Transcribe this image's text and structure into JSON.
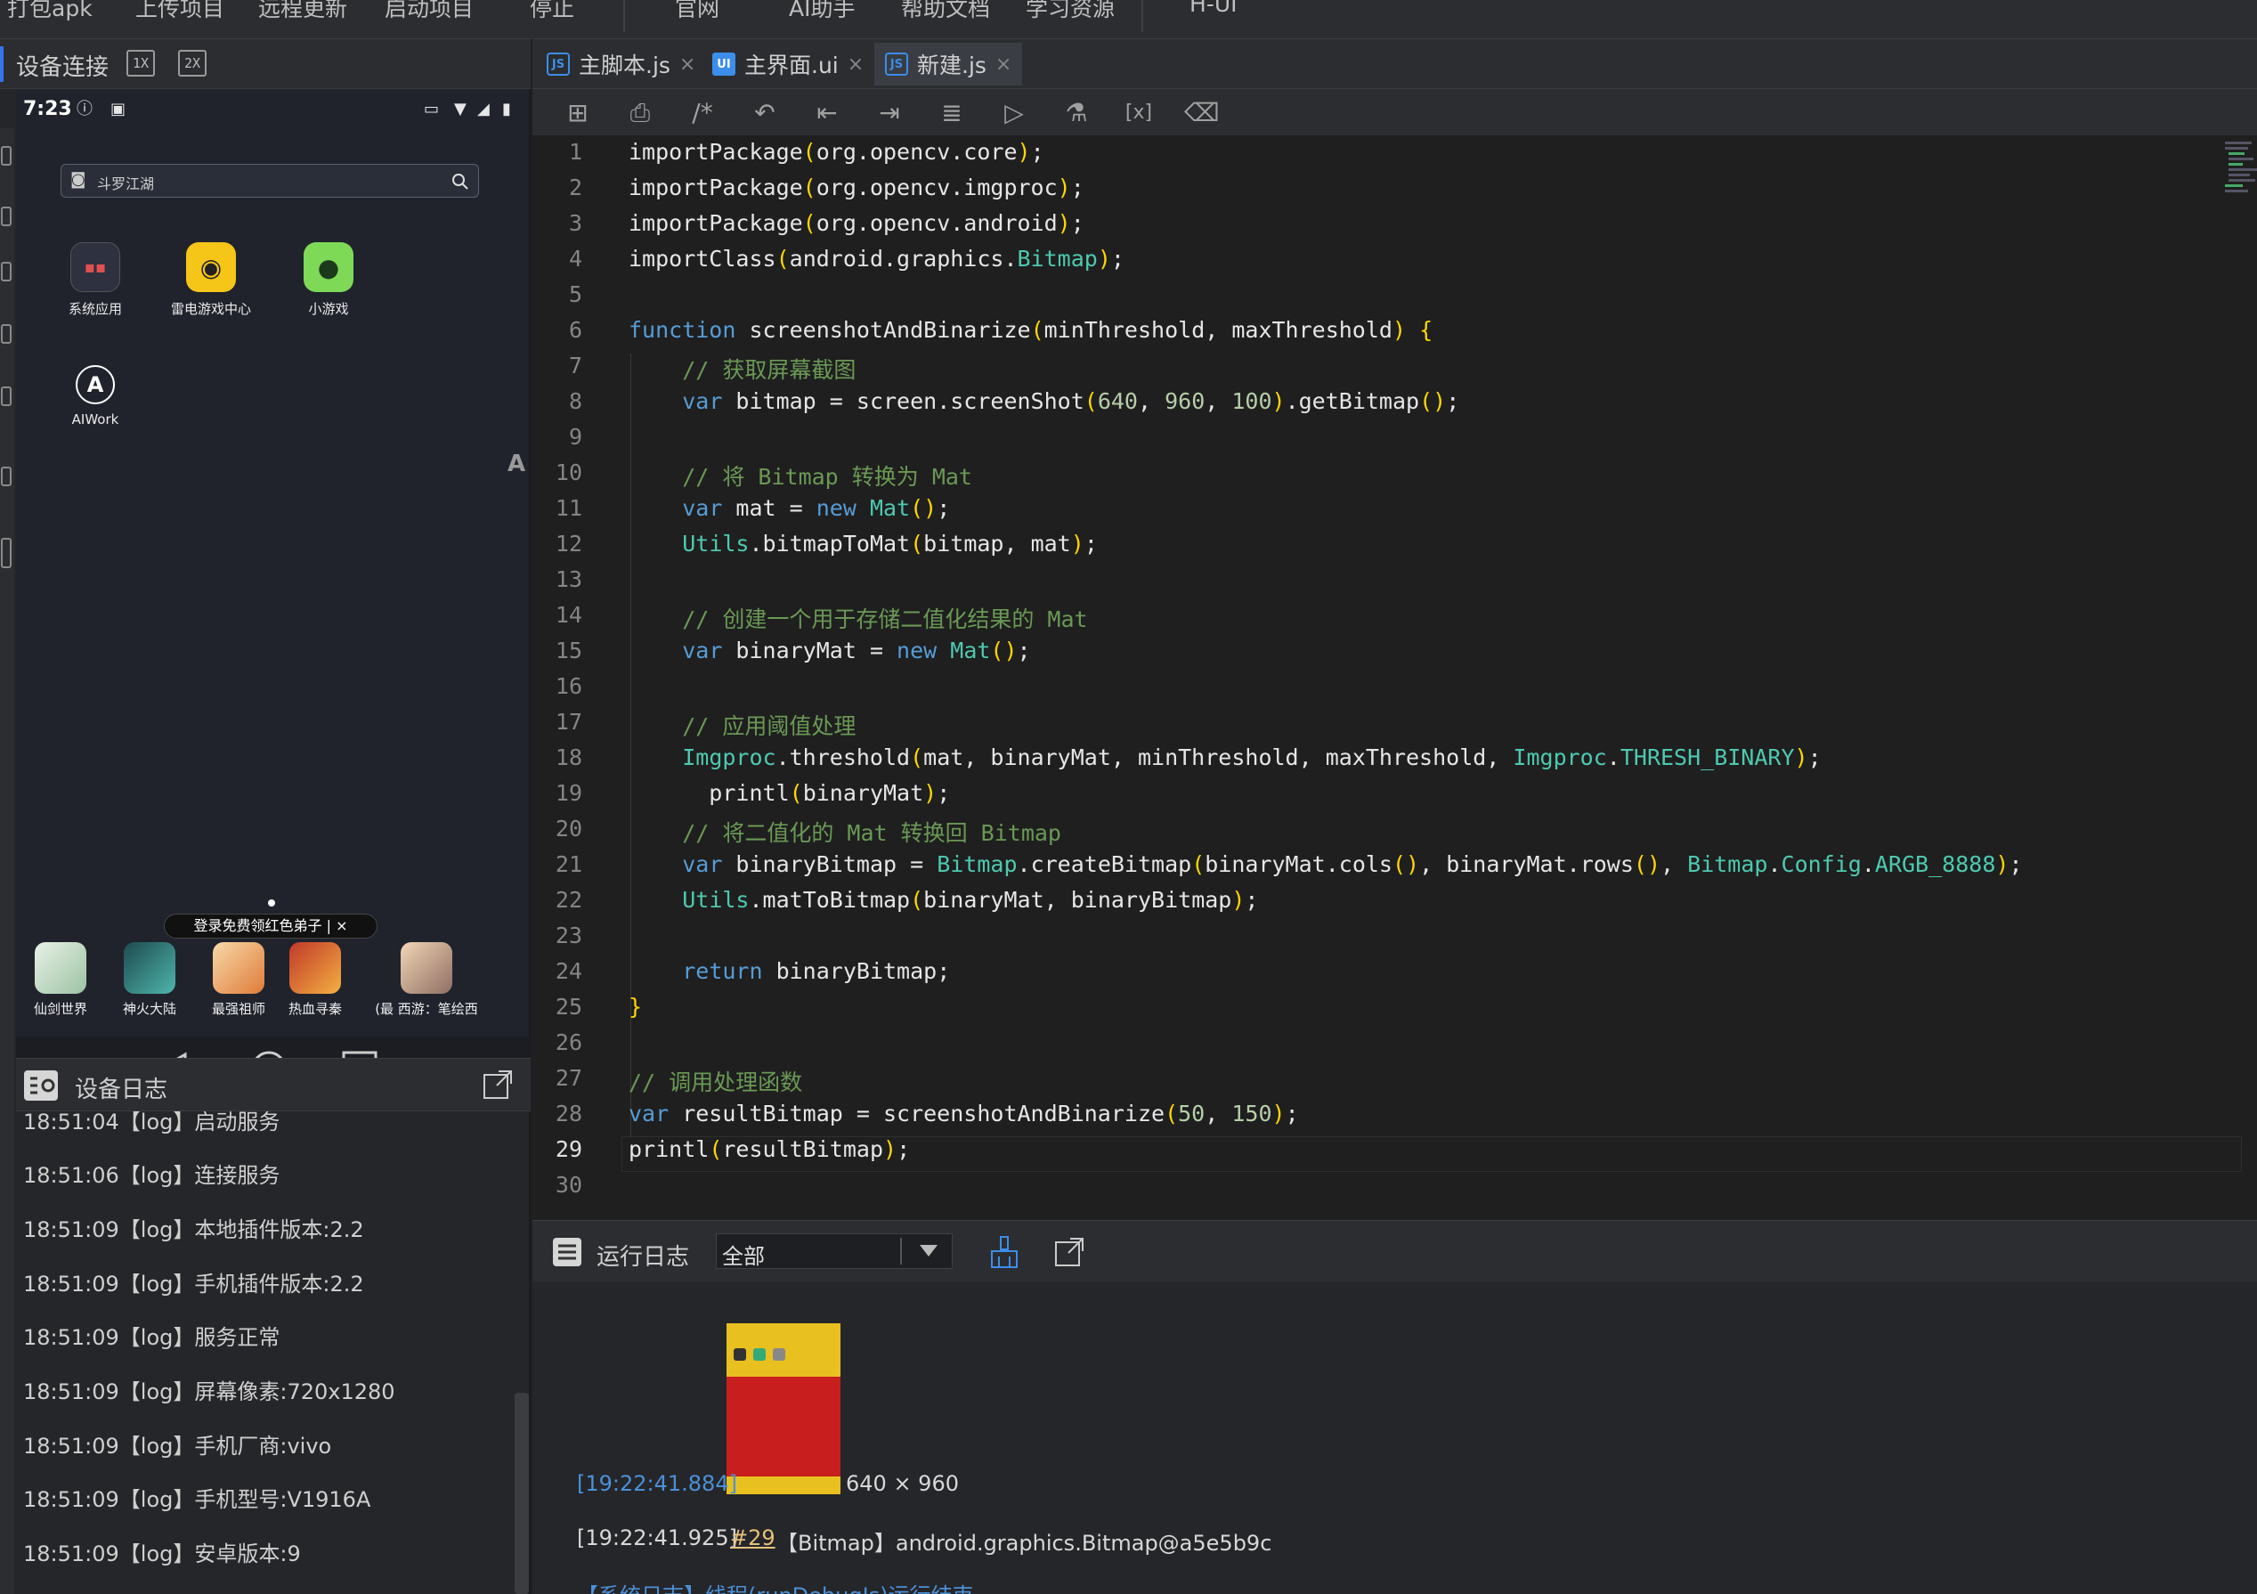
{
  "menu": {
    "items": [
      "打包apk",
      "上传项目",
      "远程更新",
      "启动项目",
      "停止",
      "官网",
      "AI助手",
      "帮助文档",
      "学习资源",
      "H-UI"
    ]
  },
  "device": {
    "title": "设备连接",
    "zoom_1x": "1X",
    "zoom_2x": "2X",
    "phone": {
      "time": "7:23",
      "search_placeholder": "斗罗江湖",
      "apps": [
        {
          "label": "系统应用"
        },
        {
          "label": "雷电游戏中心"
        },
        {
          "label": "小游戏"
        },
        {
          "label": "AIWork"
        }
      ],
      "banner": "登录免费领红色弟子 | ×",
      "dock": [
        {
          "label": "仙剑世界"
        },
        {
          "label": "神火大陆"
        },
        {
          "label": "最强祖师"
        },
        {
          "label": "热血寻秦"
        },
        {
          "label": "(最 西游：笔绘西"
        }
      ]
    },
    "log_title": "设备日志",
    "log_lines": [
      "18:51:04【log】启动服务",
      "18:51:06【log】连接服务",
      "18:51:09【log】本地插件版本:2.2",
      "18:51:09【log】手机插件版本:2.2",
      "18:51:09【log】服务正常",
      "18:51:09【log】屏幕像素:720x1280",
      "18:51:09【log】手机厂商:vivo",
      "18:51:09【log】手机型号:V1916A",
      "18:51:09【log】安卓版本:9"
    ]
  },
  "tabs": [
    {
      "label": "主脚本.js",
      "icon": "JS"
    },
    {
      "label": "主界面.ui",
      "icon": "UI"
    },
    {
      "label": "新建.js",
      "icon": "JS"
    }
  ],
  "editor": {
    "line_numbers": [
      "1",
      "2",
      "3",
      "4",
      "5",
      "6",
      "7",
      "8",
      "9",
      "10",
      "11",
      "12",
      "13",
      "14",
      "15",
      "16",
      "17",
      "18",
      "19",
      "20",
      "21",
      "22",
      "23",
      "24",
      "25",
      "26",
      "27",
      "28",
      "29",
      "30"
    ],
    "lines": [
      "importPackage(org.opencv.core);",
      "importPackage(org.opencv.imgproc);",
      "importPackage(org.opencv.android);",
      "importClass(android.graphics.Bitmap);",
      "",
      "function screenshotAndBinarize(minThreshold, maxThreshold) {",
      "    // 获取屏幕截图",
      "    var bitmap = screen.screenShot(640, 960, 100).getBitmap();",
      "",
      "    // 将 Bitmap 转换为 Mat",
      "    var mat = new Mat();",
      "    Utils.bitmapToMat(bitmap, mat);",
      "",
      "    // 创建一个用于存储二值化结果的 Mat",
      "    var binaryMat = new Mat();",
      "",
      "    // 应用阈值处理",
      "    Imgproc.threshold(mat, binaryMat, minThreshold, maxThreshold, Imgproc.THRESH_BINARY);",
      "      printl(binaryMat);",
      "    // 将二值化的 Mat 转换回 Bitmap",
      "    var binaryBitmap = Bitmap.createBitmap(binaryMat.cols(), binaryMat.rows(), Bitmap.Config.ARGB_8888);",
      "    Utils.matToBitmap(binaryMat, binaryBitmap);",
      "",
      "    return binaryBitmap;",
      "}",
      "",
      "// 调用处理函数",
      "var resultBitmap = screenshotAndBinarize(50, 150);",
      "printl(resultBitmap);",
      ""
    ]
  },
  "run_log": {
    "title": "运行日志",
    "filter": "全部",
    "entries": [
      {
        "time": "[19:22:41.884]",
        "text": "640 × 960"
      },
      {
        "time": "[19:22:41.925]",
        "link": "#29",
        "text": "【Bitmap】android.graphics.Bitmap@a5e5b9c"
      }
    ],
    "last": "【系统日志】线程(runDebugJs)运行结束"
  },
  "colors": {
    "keyword": "#569cd6",
    "comment": "#6a9955",
    "number": "#b5cea8",
    "class": "#4ec9b0",
    "bracket": "#ffd700",
    "timestamp": "#4a90d9",
    "link": "#e5c07b"
  }
}
